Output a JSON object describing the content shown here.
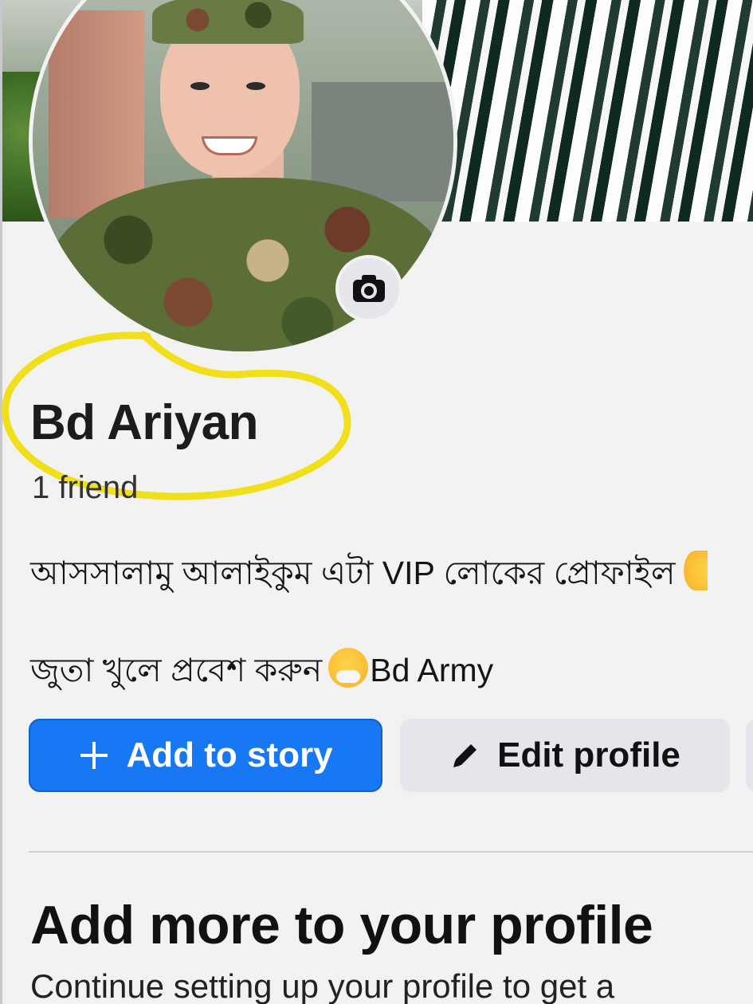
{
  "profile": {
    "name": "Bd Ariyan",
    "friends": "1 friend",
    "bio_line1": "আসসালামু আলাইকুম এটা VIP লোকের প্রোফাইল",
    "bio_line2_text": "জুতা খুলে প্রবেশ করুন",
    "bio_line2_suffix": "Bd Army"
  },
  "actions": {
    "add_story_label": "Add to story",
    "edit_profile_label": "Edit profile"
  },
  "section": {
    "title": "Add more to your profile",
    "subtitle": "Continue setting up your profile to get a"
  },
  "colors": {
    "primary": "#1877f2",
    "secondary_button": "#e4e6eb",
    "highlight_ring": "#f2e21a"
  },
  "icons": {
    "camera": "camera-icon",
    "plus": "plus-icon",
    "pencil": "pencil-icon",
    "emoji": "face-with-hand-over-mouth-emoji"
  }
}
